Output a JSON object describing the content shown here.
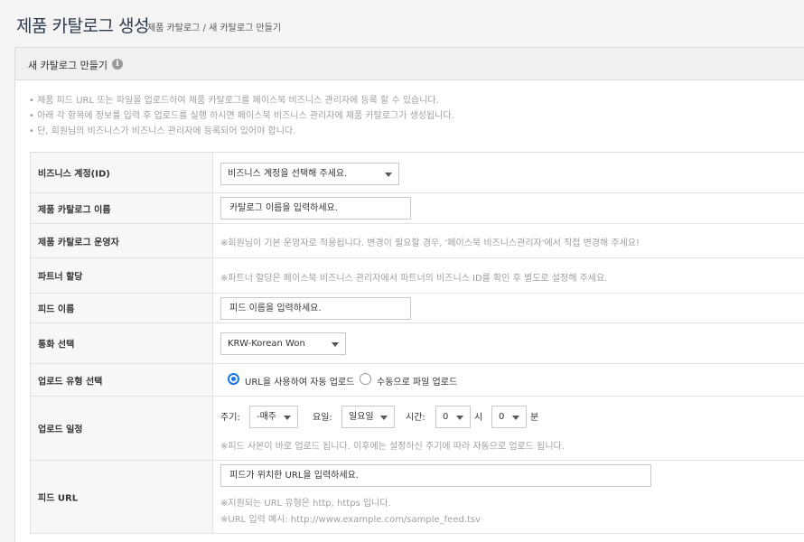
{
  "header": {
    "title": "제품 카탈로그 생성",
    "breadcrumb": "제품 카탈로그 / 새 카탈로그 만들기"
  },
  "panel": {
    "title": "새 카탈로그 만들기",
    "info_icon": "i"
  },
  "notes": [
    "• 제품 피드 URL 또는 파일을 업로드하여 제품 카탈로그를 페이스북 비즈니스 관리자에 등록 할 수 있습니다.",
    "• 아래 각 항목에 정보를 입력 후 업로드를 실행 하시면 페이스북 비즈니스 관리자에 제품 카탈로그가 생성됩니다.",
    "• 단, 회원님의 비즈니스가 비즈니스 관리자에 등록되어 있어야 합니다."
  ],
  "form": {
    "business_account": {
      "label": "비즈니스 계정(ID)",
      "value": "비즈니스 계정을 선택해 주세요."
    },
    "catalog_name": {
      "label": "제품 카탈로그 이름",
      "placeholder": "카탈로그 이름을 입력하세요."
    },
    "catalog_operator": {
      "label": "제품 카탈로그 운영자",
      "hint": "※회원님이 기본 운영자로 적용됩니다. 변경이 필요할 경우, '페이스북 비즈니스관리자'에서 직접 변경해 주세요!"
    },
    "partner": {
      "label": "파트너 할당",
      "hint": "※파트너 할당은 페이스북 비즈니스 관리자에서 파트너의 비즈니스 ID를 확인 후 별도로 설정해 주세요."
    },
    "feed_name": {
      "label": "피드 이름",
      "placeholder": "피드 이름을 입력하세요."
    },
    "currency": {
      "label": "통화 선택",
      "value": "KRW-Korean Won"
    },
    "upload_type": {
      "label": "업로드 유형 선택",
      "options": [
        "URL을 사용하여 자동 업로드",
        "수동으로 파일 업로드"
      ],
      "selected": 0
    },
    "schedule": {
      "label": "업로드 일정",
      "cycle_label": "주기:",
      "cycle_value": "-매주",
      "day_label": "요일:",
      "day_value": "일요일",
      "time_label": "시간:",
      "hour_value": "0",
      "hour_unit": "시",
      "minute_value": "0",
      "minute_unit": "분",
      "hint": "※피드 사본이 바로 업로드 됩니다. 이후에는 설정하신 주기에 따라 자동으로 업로드 됩니다."
    },
    "feed_url": {
      "label": "피드 URL",
      "placeholder": "피드가 위치한 URL을 입력하세요.",
      "hint1": "※지원되는 URL 유형은 http, https 입니다.",
      "hint2": "※URL 입력 예시: http://www.example.com/sample_feed.tsv"
    }
  },
  "colors": {
    "accent": "#1a73e8",
    "title": "#2b3a4a",
    "hint": "#a0a0a0"
  }
}
